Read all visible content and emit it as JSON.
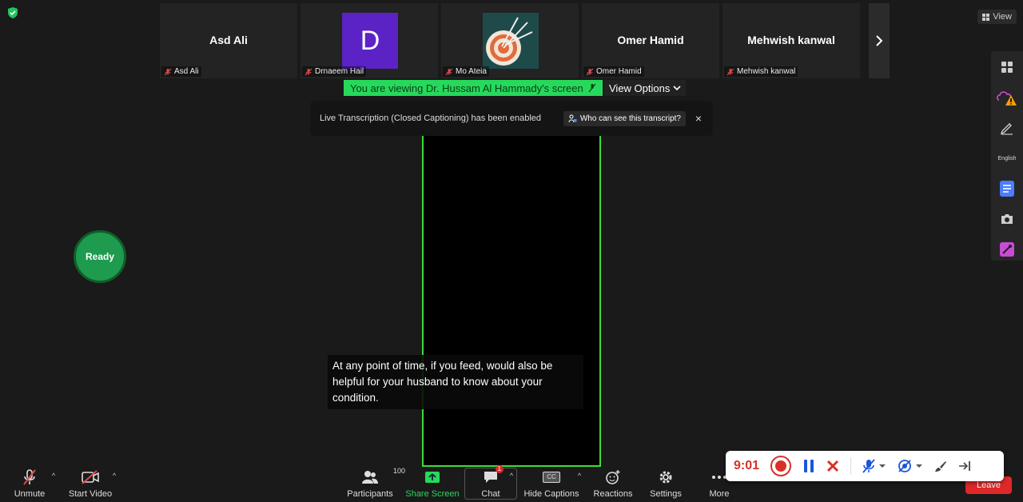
{
  "header": {
    "view_label": "View",
    "shield_color": "#22c55e"
  },
  "participants_strip": [
    {
      "big_name": "Asd Ali",
      "label": "Asd Ali",
      "avatar": "none"
    },
    {
      "big_name": "",
      "label": "Drnaeem Hail",
      "avatar": "D",
      "avatar_color": "#5b22c6"
    },
    {
      "big_name": "",
      "label": "Mo Ateia",
      "avatar": "target-icon"
    },
    {
      "big_name": "Omer Hamid",
      "label": "Omer Hamid",
      "avatar": "none"
    },
    {
      "big_name": "Mehwish kanwal",
      "label": "Mehwish kanwal",
      "avatar": "none"
    }
  ],
  "viewing_banner": {
    "text": "You are viewing Dr. Hussam Al Hammady's screen",
    "view_options_label": "View Options"
  },
  "transcription_notice": {
    "text": "Live Transcription (Closed Captioning) has been enabled",
    "who_label": "Who can see this transcript?",
    "close_label": "×"
  },
  "caption": {
    "text": "At any point of time, if you feed, would also be helpful for your husband to know about your condition."
  },
  "ready_button": {
    "label": "Ready"
  },
  "side_toolbar": {
    "language_label": "English"
  },
  "toolbar": {
    "unmute_label": "Unmute",
    "start_video_label": "Start Video",
    "participants_label": "Participants",
    "participants_count": "100",
    "share_screen_label": "Share Screen",
    "chat_label": "Chat",
    "chat_badge": "1",
    "hide_captions_label": "Hide Captions",
    "cc_label": "CC",
    "reactions_label": "Reactions",
    "settings_label": "Settings",
    "more_label": "More",
    "leave_label": "Leave"
  },
  "recording_bar": {
    "time": "9:01"
  }
}
